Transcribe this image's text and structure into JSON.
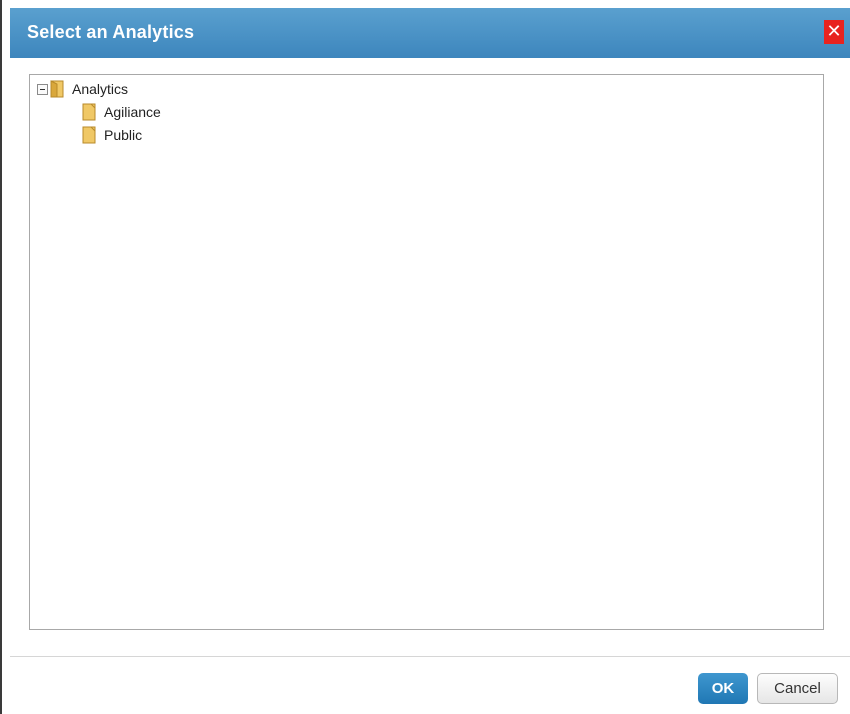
{
  "dialog": {
    "title": "Select an Analytics",
    "close_label": "✕"
  },
  "tree": {
    "root": {
      "label": "Analytics",
      "expanded": true,
      "icon": "folder-open-icon",
      "children": [
        {
          "label": "Agiliance",
          "icon": "folder-icon"
        },
        {
          "label": "Public",
          "icon": "folder-icon"
        }
      ]
    }
  },
  "footer": {
    "ok_label": "OK",
    "cancel_label": "Cancel"
  },
  "colors": {
    "titlebar": "#3d86bd",
    "close": "#e8231f",
    "ok_button": "#2a80be",
    "folder": "#e8b84a"
  }
}
